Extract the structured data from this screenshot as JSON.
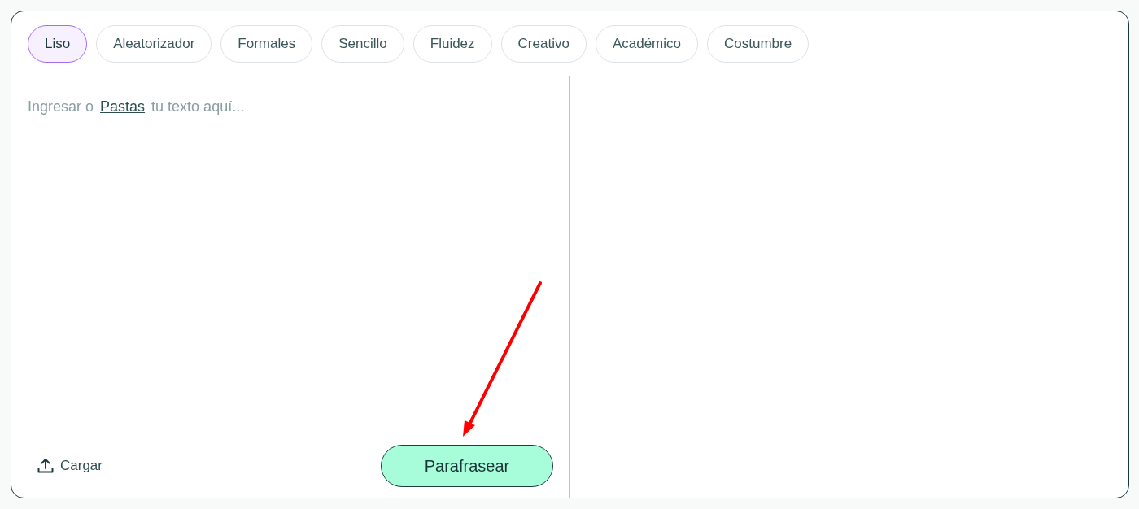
{
  "tabs": [
    {
      "label": "Liso",
      "selected": true
    },
    {
      "label": "Aleatorizador",
      "selected": false
    },
    {
      "label": "Formales",
      "selected": false
    },
    {
      "label": "Sencillo",
      "selected": false
    },
    {
      "label": "Fluidez",
      "selected": false
    },
    {
      "label": "Creativo",
      "selected": false
    },
    {
      "label": "Académico",
      "selected": false
    },
    {
      "label": "Costumbre",
      "selected": false
    }
  ],
  "input": {
    "placeholder_before": "Ingresar o",
    "paste_link": "Pastas",
    "placeholder_after": "tu texto aquí..."
  },
  "upload_button": {
    "label": "Cargar"
  },
  "submit_button": {
    "label": "Parafrasear"
  }
}
